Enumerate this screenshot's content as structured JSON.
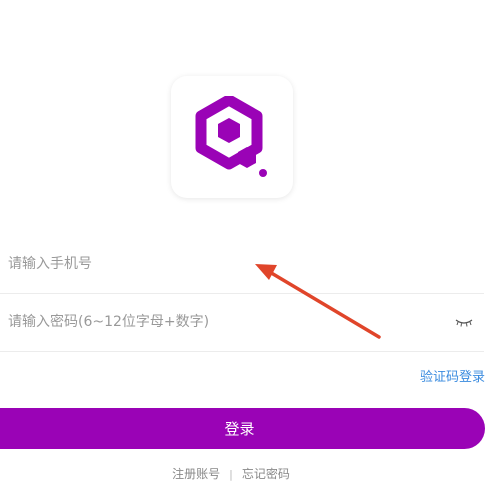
{
  "login_form": {
    "phone_placeholder": "请输入手机号",
    "password_placeholder": "请输入密码(6~12位字母+数字)",
    "sms_login_label": "验证码登录",
    "login_button_label": "登录"
  },
  "footer": {
    "register_label": "注册账号",
    "separator": "|",
    "forgot_password_label": "忘记密码"
  },
  "icons": {
    "logo": "hexagon-q-logo-icon",
    "password_visibility": "eye-closed-icon",
    "annotation": "arrow-icon"
  },
  "colors": {
    "brand_purple": "#9a03b6",
    "link_blue": "#3a8bdf",
    "annotation_red": "#e0452a"
  }
}
